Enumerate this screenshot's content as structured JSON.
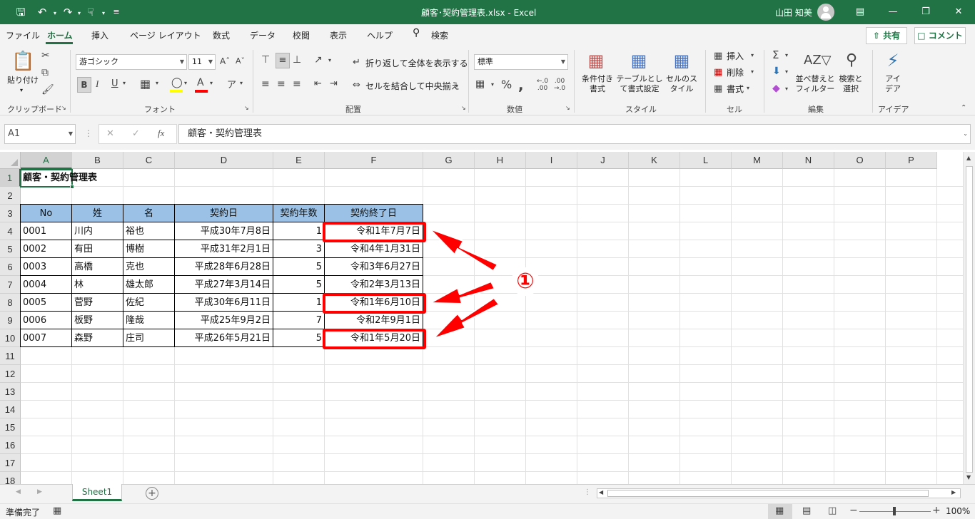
{
  "window": {
    "title": "顧客･契約管理表.xlsx  -  Excel",
    "user": "山田 知美",
    "accent": "#217346"
  },
  "quick_access": [
    "save-icon",
    "undo-icon",
    "redo-icon",
    "touch-mode-icon",
    "customize-icon"
  ],
  "menu": {
    "tabs": [
      "ファイル",
      "ホーム",
      "挿入",
      "ページ レイアウト",
      "数式",
      "データ",
      "校閲",
      "表示",
      "ヘルプ",
      "検索"
    ],
    "active": "ホーム",
    "share": "共有",
    "comment": "コメント"
  },
  "ribbon": {
    "clipboard": {
      "paste": "貼り付け",
      "label": "クリップボード"
    },
    "font": {
      "name": "游ゴシック",
      "size": "11",
      "label": "フォント",
      "bold": "B",
      "italic": "I",
      "underline": "U"
    },
    "alignment": {
      "wrap": "折り返して全体を表示する",
      "merge": "セルを結合して中央揃え",
      "label": "配置"
    },
    "number": {
      "format": "標準",
      "label": "数値"
    },
    "styles": {
      "conditional": "条件付き書式",
      "table": "テーブルとして書式設定",
      "cell": "セルのスタイル",
      "label": "スタイル"
    },
    "cells": {
      "insert": "挿入",
      "delete": "削除",
      "format": "書式",
      "label": "セル"
    },
    "editing": {
      "sort": "並べ替えとフィルター",
      "find": "検索と選択",
      "label": "編集"
    },
    "ideas": {
      "btn": "アイデア",
      "label": "アイデア"
    }
  },
  "formula_bar": {
    "name_box": "A1",
    "content": "顧客・契約管理表"
  },
  "columns": [
    "A",
    "B",
    "C",
    "D",
    "E",
    "F",
    "G",
    "H",
    "I",
    "J",
    "K",
    "L",
    "M",
    "N",
    "O",
    "P"
  ],
  "rows": [
    "1",
    "2",
    "3",
    "4",
    "5",
    "6",
    "7",
    "8",
    "9",
    "10",
    "11",
    "12",
    "13",
    "14",
    "15",
    "16",
    "17",
    "18"
  ],
  "sheet": {
    "title": "顧客・契約管理表",
    "headers": [
      "No",
      "姓",
      "名",
      "契約日",
      "契約年数",
      "契約終了日"
    ],
    "data": [
      [
        "0001",
        "川内",
        "裕也",
        "平成30年7月8日",
        "1",
        "令和1年7月7日"
      ],
      [
        "0002",
        "有田",
        "博樹",
        "平成31年2月1日",
        "3",
        "令和4年1月31日"
      ],
      [
        "0003",
        "高橋",
        "克也",
        "平成28年6月28日",
        "5",
        "令和3年6月27日"
      ],
      [
        "0004",
        "林",
        "雄太郎",
        "平成27年3月14日",
        "5",
        "令和2年3月13日"
      ],
      [
        "0005",
        "菅野",
        "佐紀",
        "平成30年6月11日",
        "1",
        "令和1年6月10日"
      ],
      [
        "0006",
        "板野",
        "隆哉",
        "平成25年9月2日",
        "7",
        "令和2年9月1日"
      ],
      [
        "0007",
        "森野",
        "庄司",
        "平成26年5月21日",
        "5",
        "令和1年5月20日"
      ]
    ]
  },
  "annotation": {
    "label": "①",
    "color": "#ff0000"
  },
  "sheet_tabs": {
    "active": "Sheet1"
  },
  "status": {
    "text": "準備完了",
    "zoom": "100%"
  }
}
